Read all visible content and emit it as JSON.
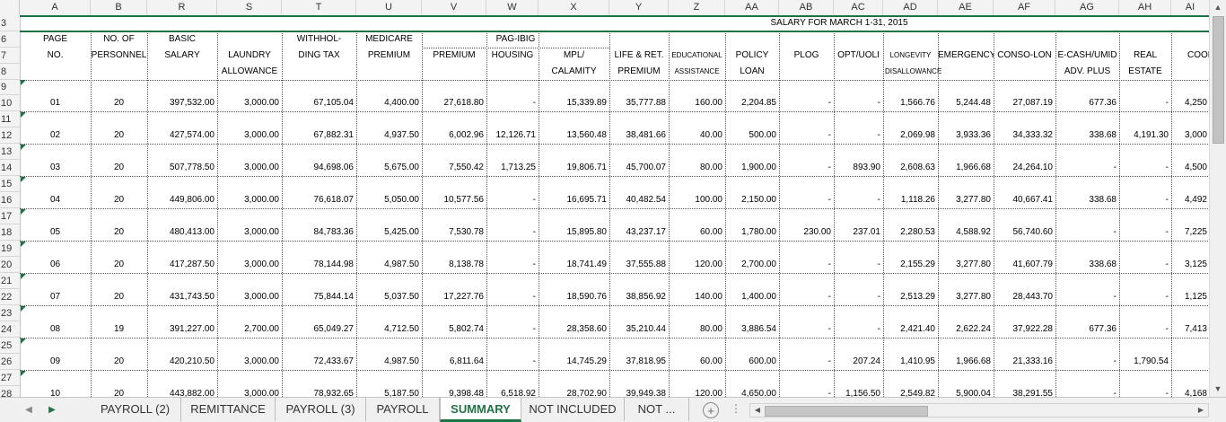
{
  "columns": [
    "A",
    "B",
    "R",
    "S",
    "T",
    "U",
    "V",
    "W",
    "X",
    "Y",
    "Z",
    "AA",
    "AB",
    "AC",
    "AD",
    "AE",
    "AF",
    "AG",
    "AH",
    "AI"
  ],
  "rows": [
    "3",
    "6",
    "7",
    "8",
    "9",
    "10",
    "11",
    "12",
    "13",
    "14",
    "15",
    "16",
    "17",
    "18",
    "19",
    "20",
    "21",
    "22",
    "23",
    "24",
    "25",
    "26",
    "27",
    "28"
  ],
  "title": "SALARY FOR MARCH 1-31, 2015",
  "headers": {
    "page1": "PAGE",
    "page2": "NO.",
    "pers1": "NO. OF",
    "pers2": "PERSONNEL",
    "basic1": "BASIC",
    "basic2": "SALARY",
    "laundry1": "LAUNDRY",
    "laundry2": "ALLOWANCE",
    "wtax1": "WITHHOL-",
    "wtax2": "DING  TAX",
    "medi1": "MEDICARE",
    "medi2": "PREMIUM",
    "pagibig": "PAG-IBIG",
    "premium": "PREMIUM",
    "housing": "HOUSING",
    "mpl1": "MPL/",
    "mpl2": "CALAMITY",
    "life1": "LIFE & RET.",
    "life2": "PREMIUM",
    "edu1": "EDUCATIONAL",
    "edu2": "ASSISTANCE",
    "policy1": "POLICY",
    "policy2": "LOAN",
    "plog": "PLOG",
    "opt": "OPT/UOLI",
    "longevity": "LONGEVITY",
    "disallowance": "DISALLOWANCE",
    "emergency": "EMERGENCY",
    "conso": "CONSO-LON",
    "ecash1": "E-CASH/UMID",
    "ecash2": "ADV. PLUS",
    "real1": "REAL",
    "real2": "ESTATE",
    "coop": "COOP"
  },
  "data": [
    {
      "row": "10",
      "page": "01",
      "pers": "20",
      "basic": "397,532.00",
      "laundry": "3,000.00",
      "wtax": "67,105.04",
      "medi": "4,400.00",
      "premium": "27,618.80",
      "housing": "-",
      "mpl": "15,339.89",
      "life": "35,777.88",
      "edu": "160.00",
      "policy": "2,204.85",
      "plog": "-",
      "opt": "-",
      "longevity": "1,566.76",
      "emergency": "5,244.48",
      "conso": "27,087.19",
      "ecash": "677.36",
      "real": "-",
      "coop": "4,250"
    },
    {
      "row": "12",
      "page": "02",
      "pers": "20",
      "basic": "427,574.00",
      "laundry": "3,000.00",
      "wtax": "67,882.31",
      "medi": "4,937.50",
      "premium": "6,002.96",
      "housing": "12,126.71",
      "mpl": "13,560.48",
      "life": "38,481.66",
      "edu": "40.00",
      "policy": "500.00",
      "plog": "-",
      "opt": "-",
      "longevity": "2,069.98",
      "emergency": "3,933.36",
      "conso": "34,333.32",
      "ecash": "338.68",
      "real": "4,191.30",
      "coop": "3,000"
    },
    {
      "row": "14",
      "page": "03",
      "pers": "20",
      "basic": "507,778.50",
      "laundry": "3,000.00",
      "wtax": "94,698.06",
      "medi": "5,675.00",
      "premium": "7,550.42",
      "housing": "1,713.25",
      "mpl": "19,806.71",
      "life": "45,700.07",
      "edu": "80.00",
      "policy": "1,900.00",
      "plog": "-",
      "opt": "893.90",
      "longevity": "2,608.63",
      "emergency": "1,966.68",
      "conso": "24,264.10",
      "ecash": "-",
      "real": "-",
      "coop": "4,500"
    },
    {
      "row": "16",
      "page": "04",
      "pers": "20",
      "basic": "449,806.00",
      "laundry": "3,000.00",
      "wtax": "76,618.07",
      "medi": "5,050.00",
      "premium": "10,577.56",
      "housing": "-",
      "mpl": "16,695.71",
      "life": "40,482.54",
      "edu": "100.00",
      "policy": "2,150.00",
      "plog": "-",
      "opt": "-",
      "longevity": "1,118.26",
      "emergency": "3,277.80",
      "conso": "40,667.41",
      "ecash": "338.68",
      "real": "-",
      "coop": "4,492"
    },
    {
      "row": "18",
      "page": "05",
      "pers": "20",
      "basic": "480,413.00",
      "laundry": "3,000.00",
      "wtax": "84,783.36",
      "medi": "5,425.00",
      "premium": "7,530.78",
      "housing": "-",
      "mpl": "15,895.80",
      "life": "43,237.17",
      "edu": "60.00",
      "policy": "1,780.00",
      "plog": "230.00",
      "opt": "237.01",
      "longevity": "2,280.53",
      "emergency": "4,588.92",
      "conso": "56,740.60",
      "ecash": "-",
      "real": "-",
      "coop": "7,225"
    },
    {
      "row": "20",
      "page": "06",
      "pers": "20",
      "basic": "417,287.50",
      "laundry": "3,000.00",
      "wtax": "78,144.98",
      "medi": "4,987.50",
      "premium": "8,138.78",
      "housing": "-",
      "mpl": "18,741.49",
      "life": "37,555.88",
      "edu": "120.00",
      "policy": "2,700.00",
      "plog": "-",
      "opt": "-",
      "longevity": "2,155.29",
      "emergency": "3,277.80",
      "conso": "41,607.79",
      "ecash": "338.68",
      "real": "-",
      "coop": "3,125"
    },
    {
      "row": "22",
      "page": "07",
      "pers": "20",
      "basic": "431,743.50",
      "laundry": "3,000.00",
      "wtax": "75,844.14",
      "medi": "5,037.50",
      "premium": "17,227.76",
      "housing": "-",
      "mpl": "18,590.76",
      "life": "38,856.92",
      "edu": "140.00",
      "policy": "1,400.00",
      "plog": "-",
      "opt": "-",
      "longevity": "2,513.29",
      "emergency": "3,277.80",
      "conso": "28,443.70",
      "ecash": "-",
      "real": "-",
      "coop": "1,125"
    },
    {
      "row": "24",
      "page": "08",
      "pers": "19",
      "basic": "391,227.00",
      "laundry": "2,700.00",
      "wtax": "65,049.27",
      "medi": "4,712.50",
      "premium": "5,802.74",
      "housing": "-",
      "mpl": "28,358.60",
      "life": "35,210.44",
      "edu": "80.00",
      "policy": "3,886.54",
      "plog": "-",
      "opt": "-",
      "longevity": "2,421.40",
      "emergency": "2,622.24",
      "conso": "37,922.28",
      "ecash": "677.36",
      "real": "-",
      "coop": "7,413"
    },
    {
      "row": "26",
      "page": "09",
      "pers": "20",
      "basic": "420,210.50",
      "laundry": "3,000.00",
      "wtax": "72,433.67",
      "medi": "4,987.50",
      "premium": "6,811.64",
      "housing": "-",
      "mpl": "14,745.29",
      "life": "37,818.95",
      "edu": "60.00",
      "policy": "600.00",
      "plog": "-",
      "opt": "207.24",
      "longevity": "1,410.95",
      "emergency": "1,966.68",
      "conso": "21,333.16",
      "ecash": "-",
      "real": "1,790.54",
      "coop": ""
    },
    {
      "row": "28",
      "page": "10",
      "pers": "20",
      "basic": "443,882.00",
      "laundry": "3,000.00",
      "wtax": "78,932.65",
      "medi": "5,187.50",
      "premium": "9,398.48",
      "housing": "6,518.92",
      "mpl": "28,702.90",
      "life": "39,949.38",
      "edu": "120.00",
      "policy": "4,650.00",
      "plog": "-",
      "opt": "1,156.50",
      "longevity": "2,549.82",
      "emergency": "5,900.04",
      "conso": "38,291.55",
      "ecash": "-",
      "real": "-",
      "coop": "4,168"
    }
  ],
  "tabs": [
    "PAYROLL (2)",
    "REMITTANCE",
    "PAYROLL (3)",
    "PAYROLL",
    "SUMMARY",
    "NOT INCLUDED",
    "NOT ..."
  ],
  "active_tab": "SUMMARY",
  "colors": {
    "accent": "#217346",
    "marker": "#1e7145"
  },
  "icons": {
    "prev": "triangle-left-icon",
    "next": "triangle-right-icon",
    "add": "plus-circle-icon"
  }
}
